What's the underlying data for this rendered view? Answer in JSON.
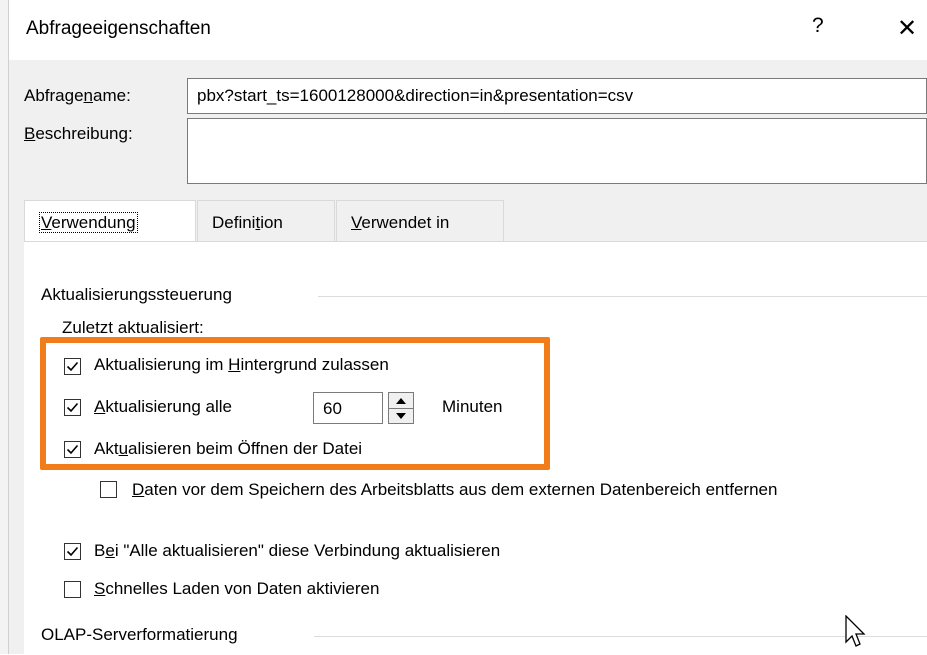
{
  "window": {
    "title": "Abfrageeigenschaften",
    "help_glyph": "?",
    "close_glyph": "✕"
  },
  "query_name": {
    "label": "Abfragename:",
    "value": "pbx?start_ts=1600128000&direction=in&presentation=csv"
  },
  "description": {
    "label": "Beschreibung:",
    "value": ""
  },
  "tabs": [
    {
      "label": "Verwendung",
      "active": true
    },
    {
      "label": "Definition",
      "active": false
    },
    {
      "label": "Verwendet in",
      "active": false
    }
  ],
  "refresh_control": {
    "group_label": "Aktualisierungssteuerung",
    "last_refreshed_label": "Zuletzt aktualisiert:",
    "background_refresh": {
      "label": "Aktualisierung im Hintergrund zulassen",
      "checked": true
    },
    "refresh_every": {
      "label": "Aktualisierung alle",
      "value": "60",
      "unit": "Minuten",
      "checked": true
    },
    "refresh_on_open": {
      "label": "Aktualisieren beim Öffnen der Datei",
      "checked": true
    },
    "remove_data": {
      "label": "Daten vor dem Speichern des Arbeitsblatts aus dem externen Datenbereich entfernen",
      "checked": false
    },
    "refresh_all": {
      "label": "Bei \"Alle aktualisieren\" diese Verbindung aktualisieren",
      "checked": true
    },
    "fast_load": {
      "label": "Schnelles Laden von Daten aktivieren",
      "checked": false
    }
  },
  "olap": {
    "group_label": "OLAP-Serverformatierung"
  },
  "colors": {
    "highlight": "#f07d1a",
    "dialog_bg": "#f0f0f0"
  },
  "icons": {
    "check": "checkmark-icon",
    "spin_up": "arrow-up-icon",
    "spin_down": "arrow-down-icon",
    "cursor": "mouse-pointer-icon"
  }
}
